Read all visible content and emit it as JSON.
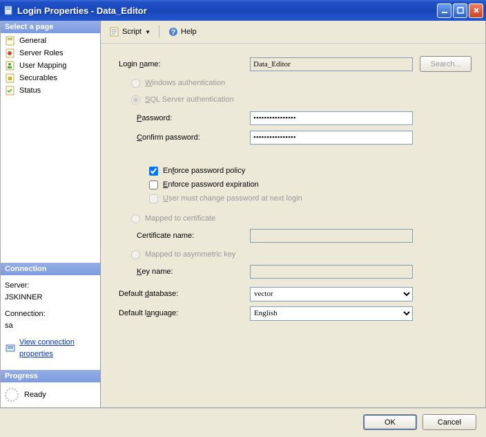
{
  "window": {
    "title": "Login Properties - Data_Editor"
  },
  "sidebar": {
    "select_page_header": "Select a page",
    "pages": [
      {
        "label": "General"
      },
      {
        "label": "Server Roles"
      },
      {
        "label": "User Mapping"
      },
      {
        "label": "Securables"
      },
      {
        "label": "Status"
      }
    ],
    "connection_header": "Connection",
    "connection": {
      "server_label": "Server:",
      "server_value": "JSKINNER",
      "connection_label": "Connection:",
      "connection_value": "sa",
      "link_text": "View connection properties"
    },
    "progress_header": "Progress",
    "progress": {
      "status": "Ready"
    }
  },
  "toolbar": {
    "script": "Script",
    "help": "Help"
  },
  "form": {
    "login_name_label": "Login name:",
    "login_name_value": "Data_Editor",
    "search_label": "Search...",
    "windows_auth_label": "Windows authentication",
    "sql_auth_label": "SQL Server authentication",
    "password_label": "Password:",
    "password_value": "••••••••••••••••",
    "confirm_password_label": "Confirm password:",
    "confirm_password_value": "••••••••••••••••",
    "enforce_policy_label": "Enforce password policy",
    "enforce_expiration_label": "Enforce password expiration",
    "must_change_label": "User must change password at next login",
    "mapped_cert_label": "Mapped to certificate",
    "cert_name_label": "Certificate name:",
    "mapped_asym_label": "Mapped to asymmetric key",
    "key_name_label": "Key name:",
    "default_db_label": "Default database:",
    "default_db_value": "vector",
    "default_lang_label": "Default language:",
    "default_lang_value": "English",
    "enforce_policy_checked": true,
    "enforce_expiration_checked": false,
    "must_change_checked": false
  },
  "footer": {
    "ok": "OK",
    "cancel": "Cancel"
  }
}
